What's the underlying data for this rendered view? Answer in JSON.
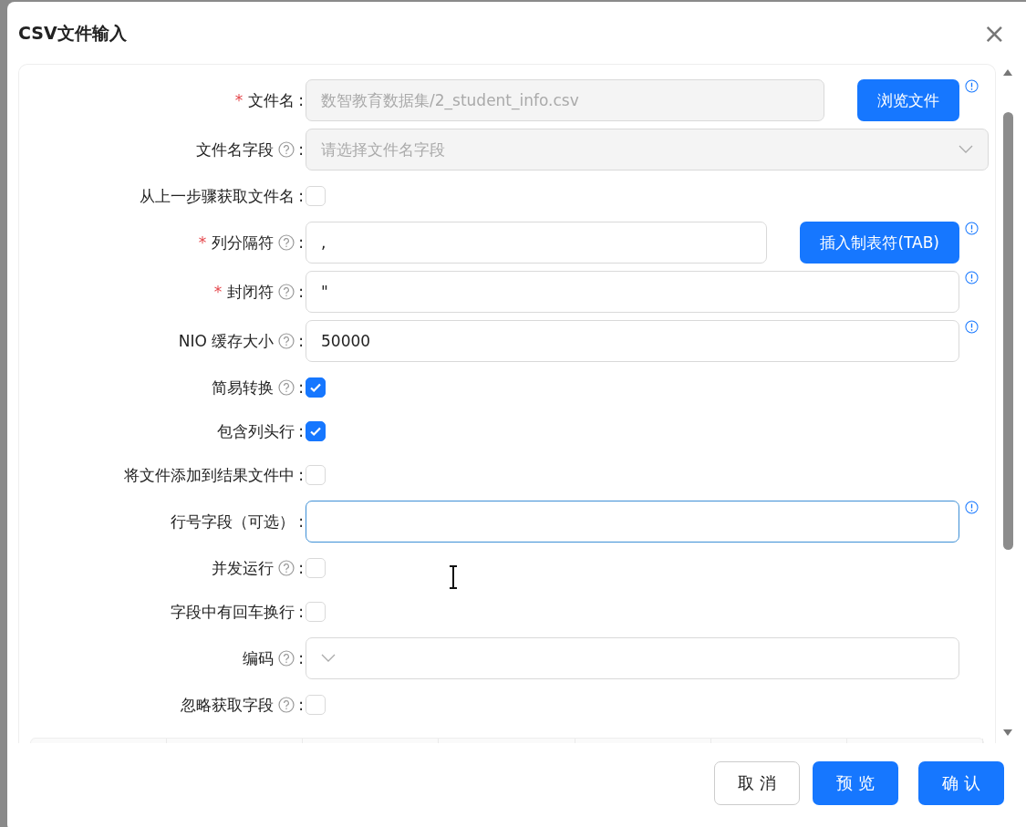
{
  "dialog": {
    "title": "CSV文件输入",
    "close": "×"
  },
  "fields": [
    {
      "kind": "input",
      "required_mark": "*",
      "label": "文件名",
      "help": false,
      "colon": ":",
      "value": "数智教育数据集/2_student_info.csv",
      "disabled": true,
      "focused": false,
      "button": "浏览文件",
      "info": true
    },
    {
      "kind": "select",
      "label": "文件名字段",
      "help": true,
      "colon": ":",
      "placeholder": "请选择文件名字段",
      "disabled": true,
      "wide": true,
      "info": false
    },
    {
      "kind": "checkbox",
      "label": "从上一步骤获取文件名",
      "help": false,
      "colon": ":",
      "checked": false
    },
    {
      "kind": "input",
      "required_mark": "*",
      "label": "列分隔符",
      "help": true,
      "colon": ":",
      "value": ",",
      "disabled": false,
      "focused": false,
      "button": "插入制表符(TAB)",
      "info": true
    },
    {
      "kind": "input",
      "required_mark": "*",
      "label": "封闭符",
      "help": true,
      "colon": ":",
      "value": "\"",
      "disabled": false,
      "focused": false,
      "info": true
    },
    {
      "kind": "input",
      "label": "NIO 缓存大小",
      "help": true,
      "colon": ":",
      "value": "50000",
      "disabled": false,
      "focused": false,
      "info": true
    },
    {
      "kind": "checkbox",
      "label": "简易转换",
      "help": true,
      "colon": ":",
      "checked": true
    },
    {
      "kind": "checkbox",
      "label": "包含列头行",
      "help": false,
      "colon": ":",
      "checked": true
    },
    {
      "kind": "checkbox",
      "label": "将文件添加到结果文件中",
      "help": false,
      "colon": ":",
      "checked": false
    },
    {
      "kind": "input",
      "label": "行号字段（可选）",
      "help": false,
      "colon": ":",
      "disabled": false,
      "focused": true,
      "info": true
    },
    {
      "kind": "checkbox",
      "label": "并发运行",
      "help": true,
      "colon": ":",
      "checked": false
    },
    {
      "kind": "checkbox",
      "label": "字段中有回车换行",
      "help": false,
      "colon": ":",
      "checked": false
    },
    {
      "kind": "select",
      "label": "编码",
      "help": true,
      "colon": ":",
      "disabled": false,
      "wide": false,
      "info": false
    },
    {
      "kind": "checkbox",
      "label": "忽略获取字段",
      "help": true,
      "colon": ":",
      "checked": false
    }
  ],
  "footer": [
    {
      "label": "取 消",
      "primary": false
    },
    {
      "label": "预 览",
      "primary": true
    },
    {
      "label": "确 认",
      "primary": true
    }
  ]
}
